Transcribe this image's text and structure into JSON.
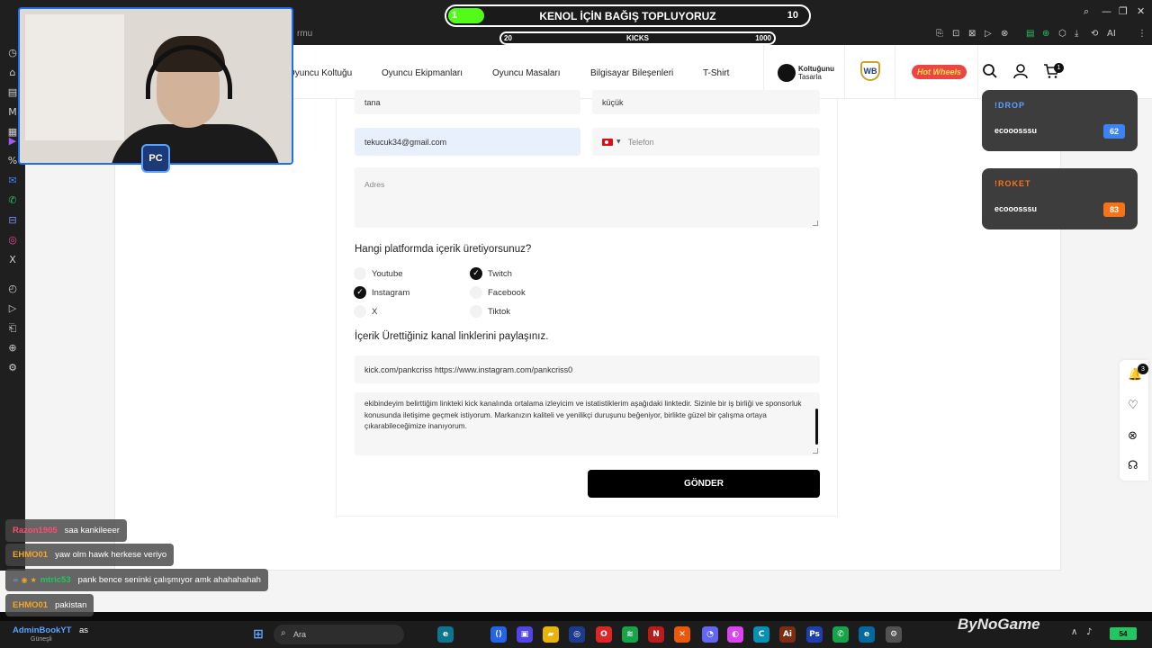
{
  "browser": {
    "address_fragment": "rmu",
    "window_controls": [
      "⌕",
      "—",
      "❐",
      "✕"
    ],
    "extension_icons": [
      "⎘",
      "⊡",
      "⊠",
      "▷",
      "⊗",
      "▤",
      "⊕",
      "⬡",
      "⤓",
      "⟲",
      "AI",
      "⋮"
    ],
    "rail_icons": [
      "◷",
      "⌂",
      "▤",
      "M",
      "▦",
      "▶",
      "%",
      "✉",
      "✆",
      "⊟",
      "◎",
      "X",
      "◴",
      "▷",
      "⎗",
      "⊕",
      "⚙"
    ]
  },
  "nav": {
    "items": [
      "Oyuncu Koltuğu",
      "Oyuncu Ekipmanları",
      "Oyuncu Masaları",
      "Bilgisayar Bileşenleri",
      "T-Shirt"
    ],
    "brand_koltuk_line1": "Koltuğunu",
    "brand_koltuk_line2": "Tasarla",
    "brand_wb": "WB",
    "brand_hotwheels": "Hot Wheels",
    "cart_count": "1"
  },
  "form": {
    "first_name": "tana",
    "last_name": "küçük",
    "email": "tekucuk34@gmail.com",
    "phone_placeholder": "Telefon",
    "address_placeholder": "Adres",
    "platform_question": "Hangi platformda içerik üretiyorsunuz?",
    "platforms": [
      {
        "label": "Youtube",
        "checked": false
      },
      {
        "label": "Twitch",
        "checked": true
      },
      {
        "label": "Instagram",
        "checked": true
      },
      {
        "label": "Facebook",
        "checked": false
      },
      {
        "label": "X",
        "checked": false
      },
      {
        "label": "Tiktok",
        "checked": false
      }
    ],
    "check_mark": "✓",
    "links_question": "İçerik Ürettiğiniz kanal linklerini paylaşınız.",
    "links_value": "kick.com/pankcriss https://www.instagram.com/pankcriss0",
    "message": "ekibindeyim belirttiğim linkteki kick kanalında ortalama izleyicim ve istatistiklerim aşağıdaki linktedir. Sizinle bir iş birliği ve sponsorluk konusunda iletişime geçmek istiyorum. Markanızın kaliteli ve yenilikçi duruşunu beğeniyor, birlikte güzel bir çalışma ortaya çıkarabileceğimize inanıyorum.",
    "submit_label": "GÖNDER"
  },
  "side_tools": {
    "notification_count": "3",
    "icons": [
      "bell-icon",
      "heart-icon",
      "compare-icon",
      "support-icon"
    ],
    "glyphs": [
      "🔔",
      "♡",
      "⊗",
      "☊"
    ]
  },
  "overlays": [
    {
      "tag": "!DROP",
      "user": "ecooosssu",
      "score": "62",
      "tag_color": "#5aa2ff",
      "score_color": "#3b82f6"
    },
    {
      "tag": "!ROKET",
      "user": "ecooosssu",
      "score": "83",
      "tag_color": "#f97316",
      "score_color": "#f97316"
    }
  ],
  "donation": {
    "start": "1",
    "title": "KENOL İÇİN BAĞIŞ TOPLUYORUZ",
    "end": "10",
    "progress": 0.1
  },
  "kicks": {
    "start": "20",
    "title": "KICKS",
    "end": "1000"
  },
  "webcam": {
    "badge": "PC"
  },
  "chat": [
    {
      "user": "Razon1905",
      "message": "saa kankileeer",
      "color": "#ff4d6d",
      "badges": []
    },
    {
      "user": "EHMO01",
      "message": "yaw olm hawk herkese veriyo",
      "color": "#f5a623",
      "badges": []
    },
    {
      "user": "mtric53",
      "message": "pank bence seninki çalışmıyor amk ahahahahah",
      "color": "#22c55e",
      "badges": [
        "∞",
        "◉",
        "★"
      ]
    },
    {
      "user": "EHMO01",
      "message": "pakistan",
      "color": "#f5a623",
      "badges": []
    }
  ],
  "taskbar": {
    "chat_user": "AdminBookYT",
    "chat_message": "as",
    "weather": "Güneşli",
    "search_placeholder": "Ara",
    "search_glyph": "⌕",
    "apps": [
      {
        "name": "windows-start-icon",
        "glyph": "⊞",
        "color": "#3b82f6"
      },
      {
        "name": "edge-icon",
        "glyph": "e",
        "color": "#0e7490"
      },
      {
        "name": "vscode-icon",
        "glyph": "⟨⟩",
        "color": "#2563eb"
      },
      {
        "name": "remote-icon",
        "glyph": "▣",
        "color": "#4f46e5"
      },
      {
        "name": "folder-icon",
        "glyph": "▰",
        "color": "#eab308"
      },
      {
        "name": "steam-icon",
        "glyph": "◎",
        "color": "#1e3a8a"
      },
      {
        "name": "opera-icon",
        "glyph": "O",
        "color": "#dc2626"
      },
      {
        "name": "spotify-icon",
        "glyph": "≋",
        "color": "#16a34a"
      },
      {
        "name": "netflix-icon",
        "glyph": "N",
        "color": "#b91c1c"
      },
      {
        "name": "xbox-icon",
        "glyph": "✕",
        "color": "#ea580c"
      },
      {
        "name": "discord-icon",
        "glyph": "◔",
        "color": "#6366f1"
      },
      {
        "name": "media-icon",
        "glyph": "◐",
        "color": "#d946ef"
      },
      {
        "name": "copilot-icon",
        "glyph": "C",
        "color": "#0891b2"
      },
      {
        "name": "illustrator-icon",
        "glyph": "Ai",
        "color": "#7c2d12"
      },
      {
        "name": "photoshop-icon",
        "glyph": "Ps",
        "color": "#1e40af"
      },
      {
        "name": "whatsapp-icon",
        "glyph": "✆",
        "color": "#16a34a"
      },
      {
        "name": "edge-alt-icon",
        "glyph": "e",
        "color": "#0369a1"
      },
      {
        "name": "settings-app-icon",
        "glyph": "⚙",
        "color": "#525252"
      }
    ],
    "watermark": "ByNoGame",
    "battery": "54",
    "tray": [
      "∧",
      "♪"
    ]
  }
}
